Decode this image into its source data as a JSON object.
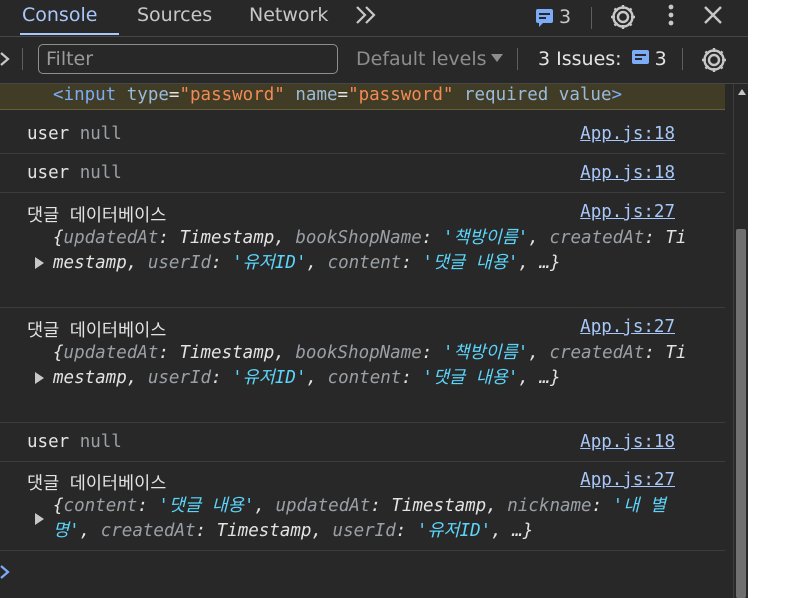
{
  "tabs": [
    {
      "label": "Console",
      "active": true
    },
    {
      "label": "Sources",
      "active": false
    },
    {
      "label": "Network",
      "active": false
    }
  ],
  "toolbar": {
    "more_tabs_icon": "double-chevron-right-icon",
    "issues_badge_count": "3",
    "settings_icon": "gear-icon",
    "menu_icon": "kebab-menu-icon",
    "close_icon": "close-icon"
  },
  "filter_bar": {
    "sidebar_icon": "chevron-right-icon",
    "filter_placeholder": "Filter",
    "filter_value": "",
    "levels_label": "Default levels",
    "issues_label": "3 Issues:",
    "issues_count": "3",
    "settings_icon": "gear-icon"
  },
  "warning_line": {
    "tag": "<input",
    "attr1": "type",
    "val1": "\"password\"",
    "attr2": "name",
    "val2": "\"password\"",
    "tail": "required value",
    "close": ">"
  },
  "entries": [
    {
      "text": "user",
      "value": "null",
      "source": "App.js:18"
    },
    {
      "text": "user",
      "value": "null",
      "source": "App.js:18"
    },
    {
      "text": "댓글 데이터베이스",
      "source": "App.js:27",
      "object": [
        {
          "k": "updatedAt",
          "v": "Timestamp",
          "t": "ts"
        },
        {
          "k": "bookShopName",
          "v": "'책방이름'",
          "t": "str"
        },
        {
          "k": "createdAt",
          "v": "Timestamp",
          "t": "ts"
        },
        {
          "k": "userId",
          "v": "'유저ID'",
          "t": "str"
        },
        {
          "k": "content",
          "v": "'댓글 내용'",
          "t": "str"
        }
      ],
      "ellipsis": "…"
    },
    {
      "text": "댓글 데이터베이스",
      "source": "App.js:27",
      "object": [
        {
          "k": "updatedAt",
          "v": "Timestamp",
          "t": "ts"
        },
        {
          "k": "bookShopName",
          "v": "'책방이름'",
          "t": "str"
        },
        {
          "k": "createdAt",
          "v": "Timestamp",
          "t": "ts"
        },
        {
          "k": "userId",
          "v": "'유저ID'",
          "t": "str"
        },
        {
          "k": "content",
          "v": "'댓글 내용'",
          "t": "str"
        }
      ],
      "ellipsis": "…"
    },
    {
      "text": "user",
      "value": "null",
      "source": "App.js:18"
    },
    {
      "text": "댓글 데이터베이스",
      "source": "App.js:27",
      "object": [
        {
          "k": "content",
          "v": "'댓글 내용'",
          "t": "str"
        },
        {
          "k": "updatedAt",
          "v": "Timestamp",
          "t": "ts"
        },
        {
          "k": "nickname",
          "v": "'내 별명'",
          "t": "str"
        },
        {
          "k": "createdAt",
          "v": "Timestamp",
          "t": "ts"
        },
        {
          "k": "userId",
          "v": "'유저ID'",
          "t": "str"
        }
      ],
      "ellipsis": "…"
    }
  ],
  "prompt_icon": "chevron-right-icon",
  "colors": {
    "panel_bg": "#282828",
    "accent": "#a8c7fa",
    "string": "#5cd5fb",
    "warning_bg": "#413c26"
  }
}
